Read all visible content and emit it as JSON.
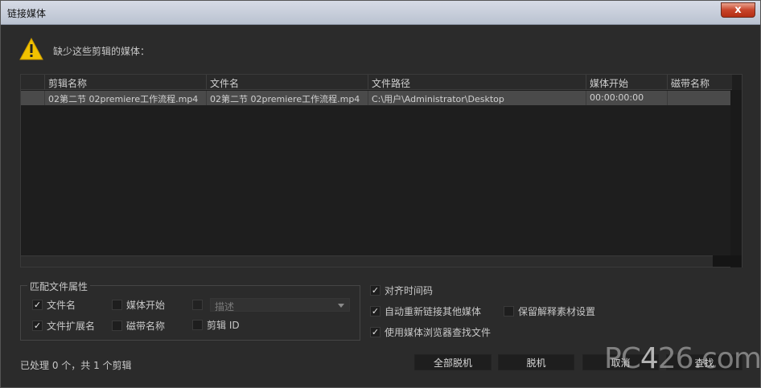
{
  "window": {
    "title": "链接媒体",
    "close_label": "x"
  },
  "missing_label": "缺少这些剪辑的媒体：",
  "table": {
    "columns": [
      "剪辑名称",
      "文件名",
      "文件路径",
      "媒体开始",
      "磁带名称"
    ],
    "rows": [
      [
        "02第二节 02premiere工作流程.mp4",
        "02第二节 02premiere工作流程.mp4",
        "C:\\用户\\Administrator\\Desktop",
        "00:00:00:00",
        ""
      ]
    ]
  },
  "match_group": {
    "title": "匹配文件属性",
    "filename": {
      "label": "文件名",
      "checked": true
    },
    "extension": {
      "label": "文件扩展名",
      "checked": true
    },
    "media_start": {
      "label": "媒体开始",
      "checked": false
    },
    "tape_name": {
      "label": "磁带名称",
      "checked": false
    },
    "description": {
      "label": "描述",
      "checked": false,
      "disabled": true
    },
    "clip_id": {
      "label": "剪辑 ID",
      "checked": false
    }
  },
  "options": {
    "align_timecode": {
      "label": "对齐时间码",
      "checked": true
    },
    "auto_relink": {
      "label": "自动重新链接其他媒体",
      "checked": true
    },
    "preserve_interpret": {
      "label": "保留解释素材设置",
      "checked": false
    },
    "use_media_browser": {
      "label": "使用媒体浏览器查找文件",
      "checked": true
    }
  },
  "status": "已处理 0 个，共 1 个剪辑",
  "buttons": {
    "offline_all": "全部脱机",
    "offline": "脱机",
    "cancel": "取消",
    "find": "查找"
  },
  "watermark": {
    "prefix": "PC",
    "number": "4",
    "suffix": "26.com"
  },
  "icons": {
    "warning": "warning-icon",
    "check": "✓"
  },
  "colors": {
    "warning": "#f2c200",
    "background": "#2b2b2b",
    "row_selected": "#4a4a4a"
  }
}
